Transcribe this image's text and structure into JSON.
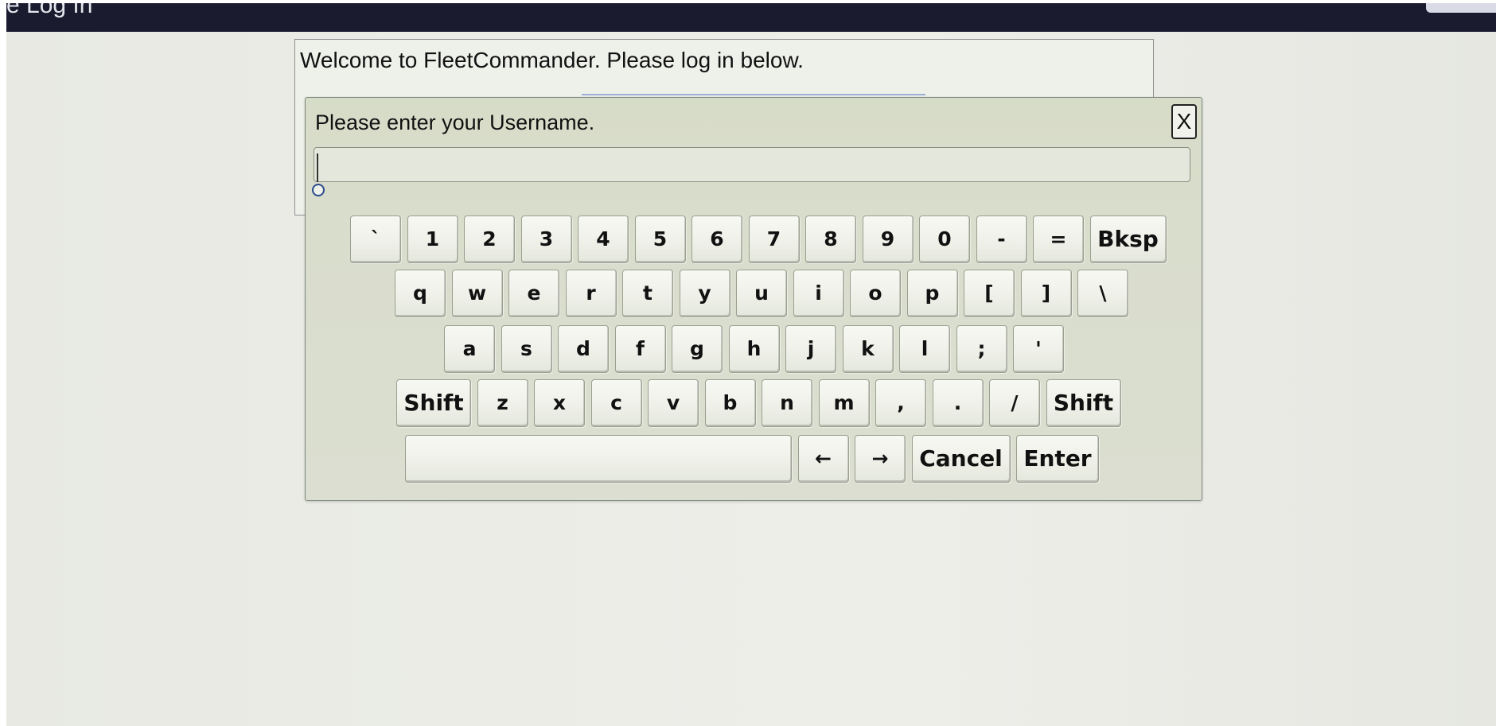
{
  "header": {
    "title": "e Log In"
  },
  "login": {
    "welcome": "Welcome to FleetCommander. Please log in below."
  },
  "keyboard_dialog": {
    "prompt": "Please enter your Username.",
    "close_label": "X",
    "entry_value": "",
    "rows": [
      [
        "`",
        "1",
        "2",
        "3",
        "4",
        "5",
        "6",
        "7",
        "8",
        "9",
        "0",
        "-",
        "=",
        "Bksp"
      ],
      [
        "q",
        "w",
        "e",
        "r",
        "t",
        "y",
        "u",
        "i",
        "o",
        "p",
        "[",
        "]",
        "\\"
      ],
      [
        "a",
        "s",
        "d",
        "f",
        "g",
        "h",
        "j",
        "k",
        "l",
        ";",
        "'"
      ],
      [
        "Shift",
        "z",
        "x",
        "c",
        "v",
        "b",
        "n",
        "m",
        ",",
        ".",
        "/",
        "Shift"
      ],
      [
        "",
        "←",
        "→",
        "Cancel",
        "Enter"
      ]
    ]
  }
}
